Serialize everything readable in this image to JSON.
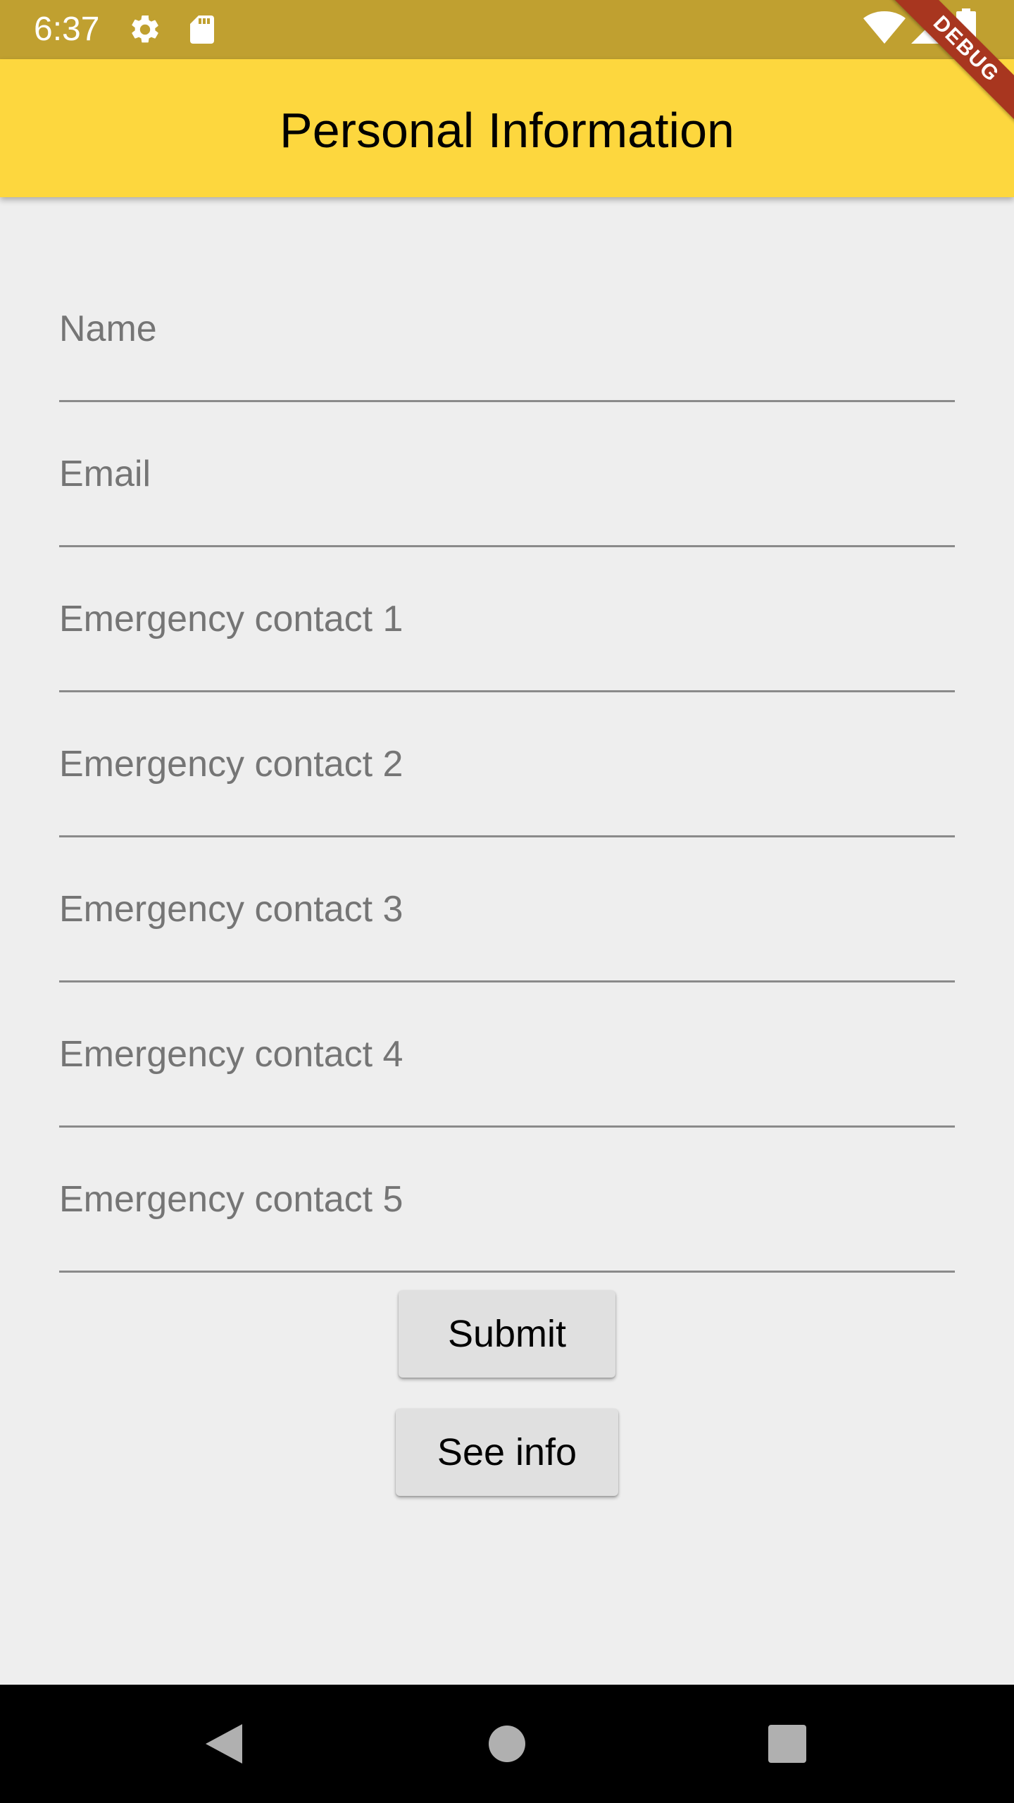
{
  "status_bar": {
    "time": "6:37",
    "icons": [
      "gear-icon",
      "sd-card-icon",
      "wifi-icon",
      "cellular-signal-icon",
      "battery-icon"
    ]
  },
  "debug_banner": "DEBUG",
  "app_bar": {
    "title": "Personal Information"
  },
  "form": {
    "fields": [
      {
        "label": "Name",
        "value": ""
      },
      {
        "label": "Email",
        "value": ""
      },
      {
        "label": "Emergency contact 1",
        "value": ""
      },
      {
        "label": "Emergency contact 2",
        "value": ""
      },
      {
        "label": "Emergency contact 3",
        "value": ""
      },
      {
        "label": "Emergency contact 4",
        "value": ""
      },
      {
        "label": "Emergency contact 5",
        "value": ""
      }
    ]
  },
  "buttons": {
    "submit": "Submit",
    "see_info": "See info"
  },
  "nav_bar": {
    "icons": [
      "back-icon",
      "home-icon",
      "recents-icon"
    ]
  },
  "colors": {
    "status_bar": "#c0a030",
    "app_bar": "#fdd73e",
    "background": "#eeeeee",
    "button": "#e0e0e0",
    "debug_ribbon": "#a8361f"
  }
}
